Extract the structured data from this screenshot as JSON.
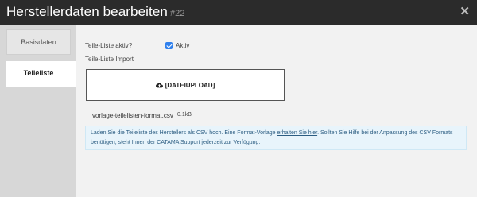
{
  "header": {
    "title": "Herstellerdaten bearbeiten",
    "record_id": "#22",
    "close_icon": "close-icon"
  },
  "sidebar": {
    "items": [
      {
        "label": "Basisdaten",
        "active": false
      },
      {
        "label": "Teileliste",
        "active": true
      }
    ]
  },
  "form": {
    "teile_liste_aktiv_label": "Teile-Liste aktiv?",
    "aktiv_checkbox_label": "Aktiv",
    "aktiv_checked": true,
    "teile_liste_import_label": "Teile-Liste Import",
    "upload_label": "[DATEIUPLOAD]",
    "upload_icon": "cloud-upload-icon",
    "file_name": "vorlage-teilelisten-format.csv",
    "file_size": "0.1kB"
  },
  "info": {
    "text_before_link": "Laden Sie die Teileliste des Herstellers als CSV hoch. Eine Format-Vorlage ",
    "link_text": "erhalten Sie hier",
    "text_after_link": ". Sollten Sie Hilfe bei der Anpassung des CSV Formats benötigen, steht Ihnen der CATAMA Support jederzeit zur Verfügung."
  },
  "colors": {
    "header_bg": "#2b2b2b",
    "sidebar_bg": "#d7d7d7",
    "content_bg": "#f2f2f2",
    "checkbox_accent": "#2f80ed",
    "info_bg": "#e8f4fb",
    "info_text": "#2c5d82"
  }
}
